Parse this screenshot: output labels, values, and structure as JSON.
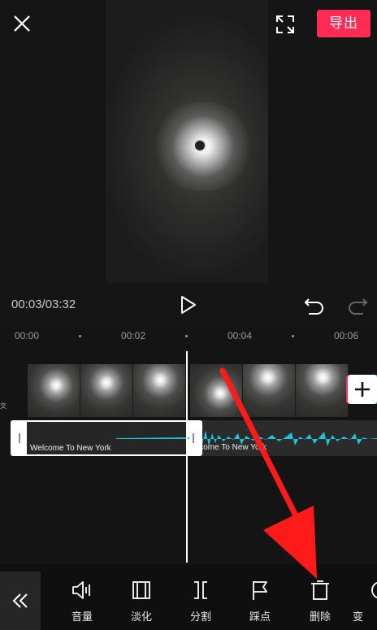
{
  "header": {
    "export_label": "导出"
  },
  "player": {
    "current_time": "00:03",
    "total_time": "03:32",
    "time_display": "00:03/03:32"
  },
  "timeline": {
    "ruler_labels": [
      "00:00",
      "00:02",
      "00:04",
      "00:06"
    ],
    "track_side_label": "文",
    "audio_clips": [
      {
        "name": "Welcome To New York"
      },
      {
        "name": "lcome To New York"
      }
    ]
  },
  "toolbar": {
    "items": [
      {
        "label": "音量",
        "icon": "volume-icon"
      },
      {
        "label": "淡化",
        "icon": "fade-icon"
      },
      {
        "label": "分割",
        "icon": "split-icon"
      },
      {
        "label": "踩点",
        "icon": "beat-flag-icon"
      },
      {
        "label": "删除",
        "icon": "delete-icon"
      },
      {
        "label": "变",
        "icon": "speed-icon"
      }
    ]
  },
  "colors": {
    "accent": "#fe2c55",
    "waveform": "#1fc3d8",
    "annotation": "#ff1a1a"
  }
}
